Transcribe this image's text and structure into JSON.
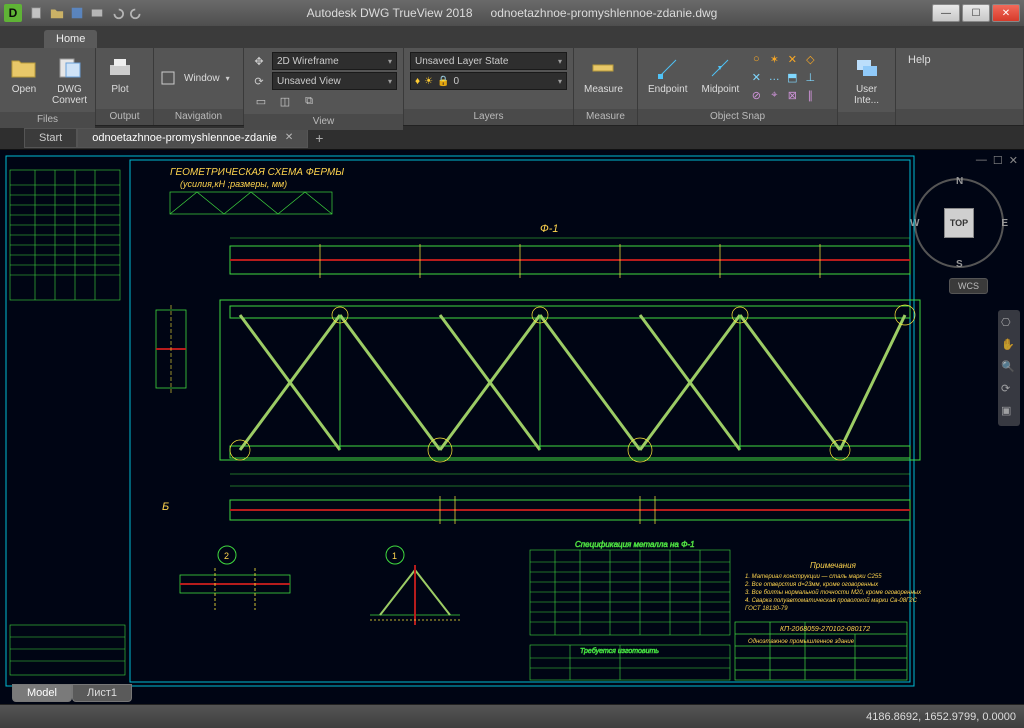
{
  "titlebar": {
    "app_name": "Autodesk DWG TrueView 2018",
    "file_name": "odnoetazhnoe-promyshlennoe-zdanie.dwg",
    "logo_letter": "D"
  },
  "ribbon": {
    "home_tab": "Home",
    "panels": {
      "files": {
        "label": "Files",
        "open": "Open",
        "dwg_convert": "DWG\nConvert"
      },
      "output": {
        "label": "Output",
        "plot": "Plot"
      },
      "navigation": {
        "label": "Navigation",
        "window": "Window"
      },
      "view": {
        "label": "View",
        "style_2d": "2D Wireframe",
        "unsaved_view": "Unsaved View"
      },
      "layers": {
        "label": "Layers",
        "state": "Unsaved Layer State",
        "current": "0"
      },
      "measure": {
        "label": "Measure",
        "measure": "Measure"
      },
      "osnap": {
        "label": "Object Snap",
        "endpoint": "Endpoint",
        "midpoint": "Midpoint"
      },
      "userint": {
        "label": "",
        "btn": "User Inte..."
      },
      "help": {
        "label": "",
        "btn": "Help"
      }
    }
  },
  "doctabs": {
    "start": "Start",
    "file": "odnoetazhnoe-promyshlennoe-zdanie"
  },
  "canvas": {
    "viewcube": {
      "top": "TOP",
      "n": "N",
      "s": "S",
      "e": "E",
      "w": "W"
    },
    "wcs": "WCS",
    "title_line1": "ГЕОМЕТРИЧЕСКАЯ СХЕМА ФЕРМЫ",
    "title_line2": "(усилия,кН ;размеры, мм)",
    "mark_f1": "Ф-1",
    "mark_b": "Б",
    "detail_1": "1",
    "detail_2": "2",
    "spec_title": "Спецификация металла на Ф-1",
    "notes_title": "Примечания",
    "note1": "1. Материал конструкции — сталь марки С255",
    "note2": "2. Все отверстия d=23мм, кроме оговоренных",
    "note3": "3. Все болты нормальной точности М20, кроме оговоренных",
    "note4": "4. Сварка полуавтоматическая проволокой марки Св-08Г2С",
    "note5": "ГОСТ 18130-79",
    "stamp_code": "КП-2068059-270102-080172",
    "stamp_line": "Одноэтажное промышленное здание",
    "req_title": "Требуется изготовить"
  },
  "bottomtabs": {
    "model": "Model",
    "sheet1": "Лист1"
  },
  "statusbar": {
    "coords": "4186.8692, 1652.9799, 0.0000"
  }
}
